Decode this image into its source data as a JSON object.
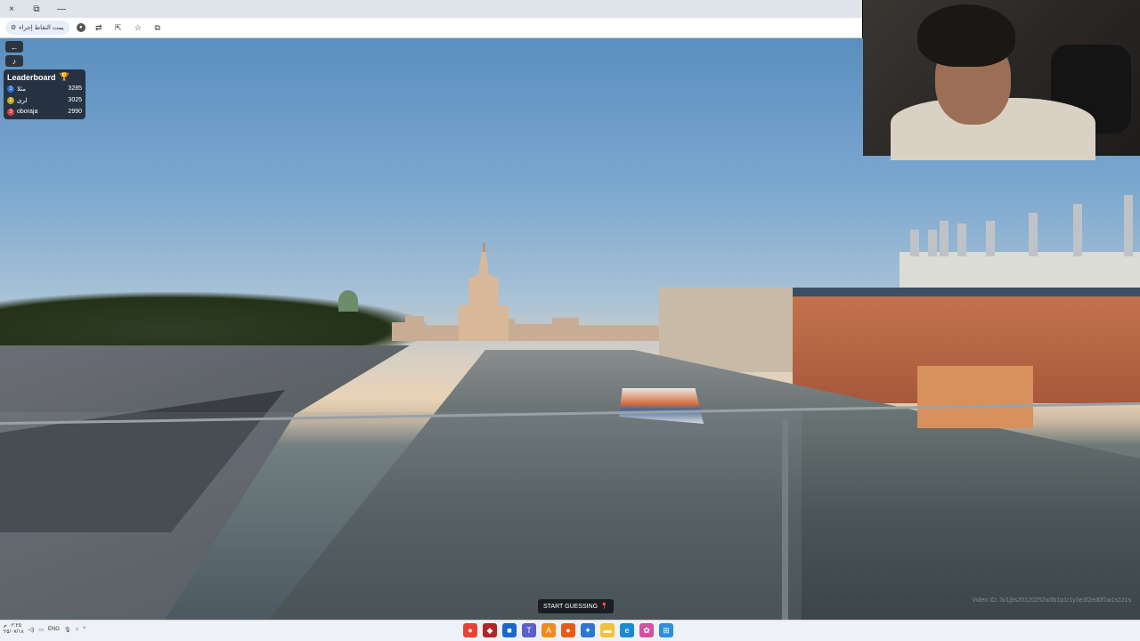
{
  "browser": {
    "window_controls": [
      "×",
      "⧉",
      "—"
    ],
    "address_label": "يمت التقاط إجراء",
    "toolbar_icons": [
      "profile-icon",
      "translate-icon",
      "share-icon",
      "star-icon",
      "extensions-icon"
    ]
  },
  "game": {
    "back_icon": "back-arrow-icon",
    "sound_icon": "speaker-icon",
    "leaderboard": {
      "title": "Leaderboard",
      "trophy_icon": "trophy-icon",
      "rows": [
        {
          "rank": "1",
          "name": "مثلا",
          "score": "3285",
          "color": "#2f6fdd"
        },
        {
          "rank": "2",
          "name": "لرى",
          "score": "3025",
          "color": "#c9a618"
        },
        {
          "rank": "3",
          "name": "oboraja",
          "score": "2990",
          "color": "#d93a3a"
        }
      ]
    },
    "start_button": "START GUESSING",
    "pin_icon": "map-pin-icon",
    "video_id": "Video ID: 3v1j9s20120252w3b1p1r1y3e3f2ed0f1w1s1z1s"
  },
  "taskbar": {
    "clock": "٠٢:٢٥ م",
    "date": "٢٥/٠٧/١٨",
    "lang": "ENG",
    "apps": [
      {
        "name": "chrome-icon",
        "color": "#e94235",
        "glyph": "●"
      },
      {
        "name": "game-icon",
        "color": "#b02525",
        "glyph": "◆"
      },
      {
        "name": "store-icon",
        "color": "#1b6ac9",
        "glyph": "■"
      },
      {
        "name": "teams-icon",
        "color": "#5b5fc7",
        "glyph": "T"
      },
      {
        "name": "app-a-icon",
        "color": "#f28a1f",
        "glyph": "A"
      },
      {
        "name": "firefox-icon",
        "color": "#e8591a",
        "glyph": "●"
      },
      {
        "name": "app-blue-icon",
        "color": "#2d76d2",
        "glyph": "✦"
      },
      {
        "name": "folder-icon",
        "color": "#f2c23a",
        "glyph": "▬"
      },
      {
        "name": "edge-icon",
        "color": "#1b8ad0",
        "glyph": "e"
      },
      {
        "name": "app-color-icon",
        "color": "#d44fa0",
        "glyph": "✿"
      },
      {
        "name": "windows-icon",
        "color": "#2d8fe0",
        "glyph": "⊞"
      }
    ]
  }
}
